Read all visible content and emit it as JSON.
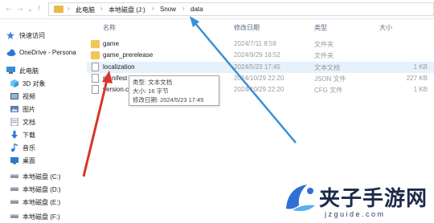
{
  "address": {
    "crumbs": [
      "此电脑",
      "本地磁盘 (J:)",
      "Snow",
      "data"
    ]
  },
  "sidebar": {
    "items": [
      {
        "label": "快速访问",
        "icon": "pin-icon"
      },
      {
        "label": "OneDrive - Persona",
        "icon": "cloud-icon"
      },
      {
        "label": "此电脑",
        "icon": "computer-icon"
      },
      {
        "label": "3D 对象",
        "icon": "cube-icon"
      },
      {
        "label": "视频",
        "icon": "video-icon"
      },
      {
        "label": "图片",
        "icon": "picture-icon"
      },
      {
        "label": "文档",
        "icon": "document-icon"
      },
      {
        "label": "下载",
        "icon": "download-icon"
      },
      {
        "label": "音乐",
        "icon": "music-icon"
      },
      {
        "label": "桌面",
        "icon": "desktop-icon"
      },
      {
        "label": "本地磁盘 (C:)",
        "icon": "drive-icon"
      },
      {
        "label": "本地磁盘 (D:)",
        "icon": "drive-icon"
      },
      {
        "label": "本地磁盘 (E:)",
        "icon": "drive-icon"
      },
      {
        "label": "本地磁盘 (F:)",
        "icon": "drive-icon"
      }
    ]
  },
  "columns": {
    "name": "名称",
    "date": "修改日期",
    "type": "类型",
    "size": "大小"
  },
  "files": [
    {
      "name": "game",
      "date": "2024/7/11 8:59",
      "type": "文件夹",
      "size": "",
      "kind": "folder"
    },
    {
      "name": "game_prerelease",
      "date": "2024/9/29 16:52",
      "type": "文件夹",
      "size": "",
      "kind": "folder"
    },
    {
      "name": "localization",
      "date": "2024/5/23 17:45",
      "type": "文本文档",
      "size": "1 KB",
      "kind": "doc"
    },
    {
      "name": "manifest",
      "date": "2024/10/29 22:20",
      "type": "JSON 文件",
      "size": "227 KB",
      "kind": "doc"
    },
    {
      "name": "version.c",
      "date": "2024/10/29 22:20",
      "type": "CFG 文件",
      "size": "1 KB",
      "kind": "doc"
    }
  ],
  "tooltip": {
    "type_line": "类型: 文本文档",
    "size_line": "大小: 16 字节",
    "date_line": "修改日期: 2024/5/23 17:45"
  },
  "watermark": {
    "title": "夹子手游网",
    "url": "jzguide.com"
  },
  "colors": {
    "arrow_red": "#d9362b",
    "arrow_blue": "#3a8fd6",
    "selected_row": "#e5f1fb",
    "folder": "#f2c45a"
  }
}
